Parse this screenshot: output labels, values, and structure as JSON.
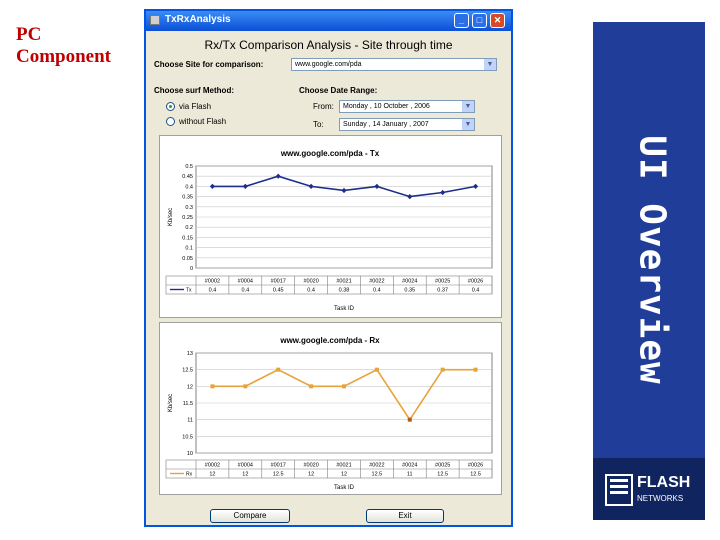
{
  "slide": {
    "title_line1": "PC",
    "title_line2": "Component",
    "sidebar_text": "UI Overview",
    "logo_word": "FLASH",
    "logo_sub": "NETWORKS"
  },
  "window": {
    "title": "TxRxAnalysis",
    "controls": [
      "_",
      "□",
      "✕"
    ],
    "heading": "Rx/Tx Comparison Analysis - Site through time",
    "site_label": "Choose Site for comparison:",
    "site_value": "www.google.com/pda",
    "method_label": "Choose surf Method:",
    "method_options": [
      "via Flash",
      "without Flash"
    ],
    "method_selected": 0,
    "date_label": "Choose Date Range:",
    "from_label": "From:",
    "from_value": "Monday , 10 October , 2006",
    "to_label": "To:",
    "to_value": "Sunday , 14 January , 2007",
    "buttons": [
      "Compare",
      "Exit"
    ],
    "colors": {
      "accent": "#0055e5",
      "tx_series": "#1c2e8c",
      "rx_series": "#e8a23a",
      "rx_low_point": "#b85a10"
    }
  },
  "chart_data": [
    {
      "type": "line",
      "title": "www.google.com/pda - Tx",
      "ylabel": "Kb/sec",
      "xlabel": "Task ID",
      "categories": [
        "#0002",
        "#0004",
        "#0017",
        "#0020",
        "#0021",
        "#0022",
        "#0024",
        "#0025",
        "#0026"
      ],
      "series": [
        {
          "name": "Tx",
          "values": [
            0.4,
            0.4,
            0.45,
            0.4,
            0.38,
            0.4,
            0.35,
            0.37,
            0.4
          ]
        }
      ],
      "table_values": [
        "0.4",
        "0.4",
        "0.45",
        "0.4",
        "0.38",
        "0.4",
        "0.35",
        "0.37",
        "0.4"
      ],
      "yticks": [
        "0",
        "0.05",
        "0.1",
        "0.15",
        "0.2",
        "0.25",
        "0.3",
        "0.35",
        "0.4",
        "0.45",
        "0.5"
      ],
      "ylim": [
        0,
        0.5
      ],
      "grid": true,
      "legend": "data-table"
    },
    {
      "type": "line",
      "title": "www.google.com/pda - Rx",
      "ylabel": "Kb/sec",
      "xlabel": "Task ID",
      "categories": [
        "#0002",
        "#0004",
        "#0017",
        "#0020",
        "#0021",
        "#0022",
        "#0024",
        "#0025",
        "#0026"
      ],
      "series": [
        {
          "name": "Rx",
          "values": [
            12,
            12,
            12.5,
            12,
            12,
            12.5,
            11,
            12.5,
            12.5
          ]
        }
      ],
      "table_values": [
        "12",
        "12",
        "12.5",
        "12",
        "12",
        "12.5",
        "11",
        "12.5",
        "12.5"
      ],
      "yticks": [
        "10",
        "10.5",
        "11",
        "11.5",
        "12",
        "12.5",
        "13"
      ],
      "ylim": [
        10,
        13
      ],
      "grid": true,
      "legend": "data-table"
    }
  ]
}
